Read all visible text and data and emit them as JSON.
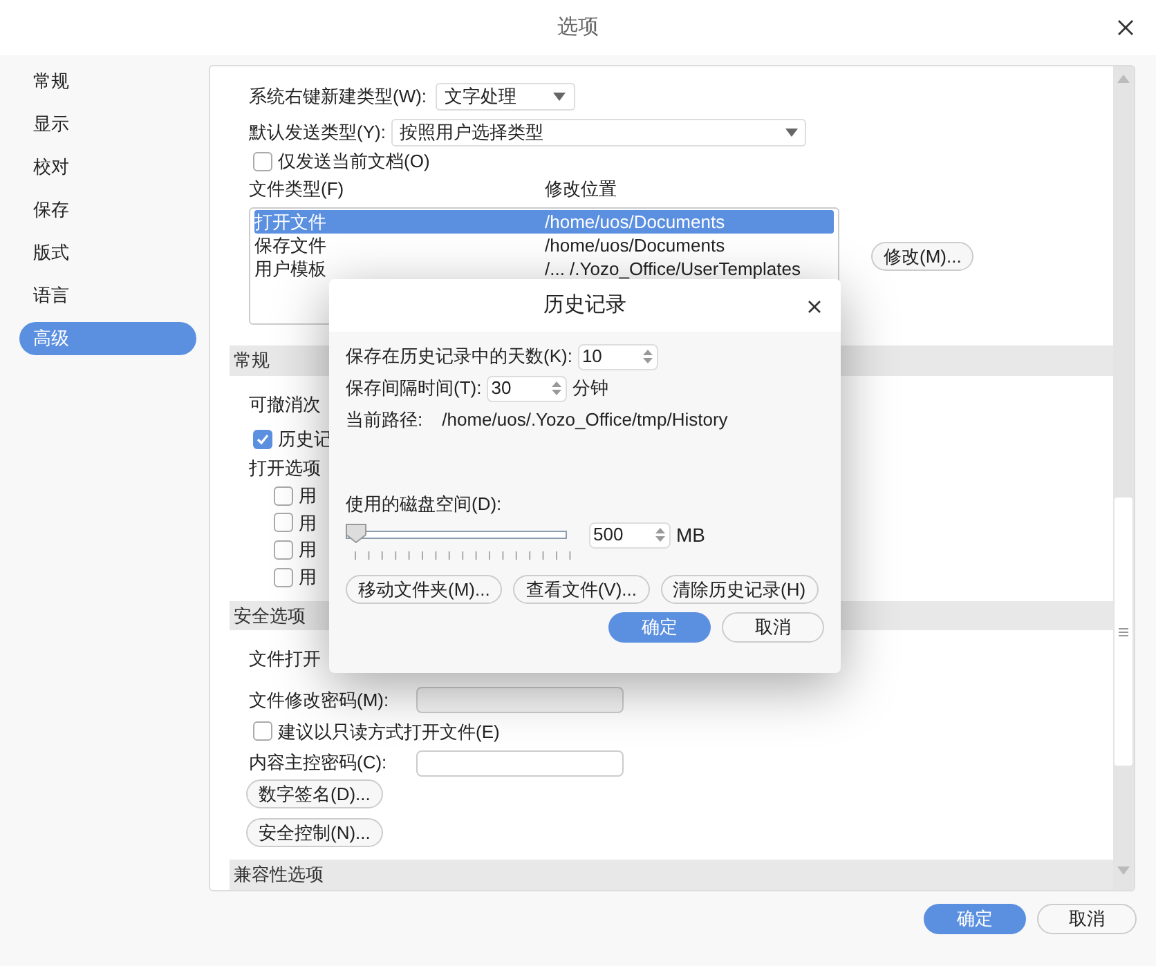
{
  "window": {
    "title": "选项"
  },
  "sidebar": {
    "items": [
      {
        "label": "常规",
        "selected": false
      },
      {
        "label": "显示",
        "selected": false
      },
      {
        "label": "校对",
        "selected": false
      },
      {
        "label": "保存",
        "selected": false
      },
      {
        "label": "版式",
        "selected": false
      },
      {
        "label": "语言",
        "selected": false
      },
      {
        "label": "高级",
        "selected": true
      }
    ]
  },
  "general": {
    "new_type_label": "系统右键新建类型(W):",
    "new_type_value": "文字处理",
    "send_type_label": "默认发送类型(Y):",
    "send_type_value": "按照用户选择类型",
    "send_current": {
      "label": "仅发送当前文档(O)",
      "checked": false
    },
    "file_columns": [
      "文件类型(F)",
      "修改位置"
    ],
    "file_rows": [
      {
        "type": "打开文件",
        "location": "/home/uos/Documents",
        "selected": true
      },
      {
        "type": "保存文件",
        "location": "/home/uos/Documents",
        "selected": false
      },
      {
        "type": "用户模板",
        "location": "/... /.Yozo_Office/UserTemplates",
        "selected": false
      }
    ],
    "modify_button": "修改(M)..."
  },
  "sections": [
    {
      "title": "常规"
    },
    {
      "title": "安全选项"
    },
    {
      "title": "兼容性选项"
    }
  ],
  "common": {
    "undo_label": "可撤消次",
    "history": {
      "label": "历史记",
      "checked": true
    },
    "open_options_label": "打开选项",
    "open_options": [
      {
        "label": "用",
        "checked": false
      },
      {
        "label": "用",
        "checked": false
      },
      {
        "label": "用",
        "checked": false
      },
      {
        "label": "用",
        "checked": false
      }
    ]
  },
  "security": {
    "open_password_label": "文件打开",
    "modify_password_label": "文件修改密码(M):",
    "readonly": {
      "label": "建议以只读方式打开文件(E)",
      "checked": false
    },
    "master_password_label": "内容主控密码(C):",
    "buttons": [
      "数字签名(D)...",
      "安全控制(N)..."
    ]
  },
  "buttons": {
    "ok": "确定",
    "cancel": "取消"
  },
  "history_dialog": {
    "title": "历史记录",
    "days_label": "保存在历史记录中的天数(K):",
    "days_value": "10",
    "interval_label": "保存间隔时间(T):",
    "interval_value": "30",
    "interval_unit": "分钟",
    "path_label": "当前路径:",
    "path_value": "/home/uos/.Yozo_Office/tmp/History",
    "disk_label": "使用的磁盘空间(D):",
    "disk": {
      "level": 0
    },
    "disk_value": "500",
    "disk_unit": "MB",
    "actions": [
      "移动文件夹(M)...",
      "查看文件(V)...",
      "清除历史记录(H)"
    ],
    "ok": "确定",
    "cancel": "取消"
  }
}
